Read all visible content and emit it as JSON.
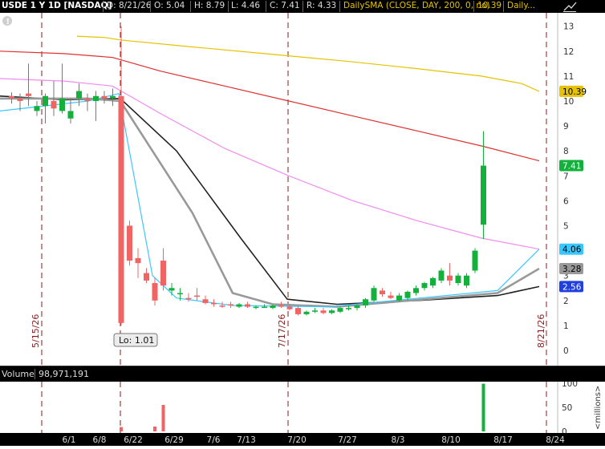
{
  "header": {
    "symbol": "USDE 1 Y 1D [NASDAQ]",
    "date": "D: 8/21/26",
    "open": "O: 5.04",
    "high": "H: 8.79",
    "low": "L: 4.46",
    "close": "C: 7.41",
    "range": "R: 4.33",
    "study": "DailySMA (CLOSE, DAY, 200, 0, no)",
    "study_value": "10.39",
    "more": "Daily..."
  },
  "price_axis": {
    "ticks": [
      13,
      12,
      11,
      10,
      9,
      8,
      7,
      6,
      5,
      4,
      3,
      2,
      1,
      0
    ],
    "tags": [
      {
        "text": "10.39",
        "value": 10.39,
        "bg": "#e6c200",
        "fg": "#000"
      },
      {
        "text": "7.41",
        "value": 7.41,
        "bg": "#13b13b",
        "fg": "#fff"
      },
      {
        "text": "4.06",
        "value": 4.06,
        "bg": "#38c8ff",
        "fg": "#000"
      },
      {
        "text": "3.28",
        "value": 3.28,
        "bg": "#999999",
        "fg": "#000"
      },
      {
        "text": "2.56",
        "value": 2.56,
        "bg": "#1f3fe0",
        "fg": "#fff"
      }
    ]
  },
  "event_labels": [
    "5/15/26",
    "7/17/26",
    "8/21/26"
  ],
  "lo_label": "Lo: 1.01",
  "volume": {
    "label": "Volume",
    "value": "98,971,191",
    "ticks": [
      "100",
      "50",
      "0"
    ],
    "unit": "<millions>"
  },
  "x_axis": {
    "labels": [
      "6/1",
      "6/8",
      "6/22",
      "6/29",
      "7/6",
      "7/13",
      "7/20",
      "7/27",
      "8/3",
      "8/10",
      "8/17",
      "8/24"
    ]
  },
  "colors": {
    "up": "#13b13b",
    "down": "#f06464",
    "sma200": "#e6c200",
    "ma_red": "#e03030",
    "ma_pink": "#f08cf0",
    "ma_black": "#222222",
    "ma_gray": "#999999",
    "ma_cyan": "#38c8ff"
  },
  "chart_data": {
    "type": "candlestick",
    "candles": [
      {
        "o": 10.2,
        "h": 10.35,
        "l": 9.9,
        "c": 10.1
      },
      {
        "o": 10.1,
        "h": 10.3,
        "l": 9.6,
        "c": 10.0
      },
      {
        "o": 10.3,
        "h": 11.5,
        "l": 9.8,
        "c": 10.2
      },
      {
        "o": 9.6,
        "h": 10.0,
        "l": 9.4,
        "c": 9.8
      },
      {
        "o": 9.8,
        "h": 10.3,
        "l": 9.1,
        "c": 10.2
      },
      {
        "o": 10.0,
        "h": 10.8,
        "l": 9.4,
        "c": 9.7
      },
      {
        "o": 9.6,
        "h": 11.5,
        "l": 9.5,
        "c": 10.1
      },
      {
        "o": 9.3,
        "h": 10.1,
        "l": 9.1,
        "c": 9.6
      },
      {
        "o": 10.1,
        "h": 10.7,
        "l": 9.8,
        "c": 10.4
      },
      {
        "o": 10.1,
        "h": 10.3,
        "l": 9.6,
        "c": 10.0
      },
      {
        "o": 10.0,
        "h": 10.4,
        "l": 9.2,
        "c": 10.2
      },
      {
        "o": 10.2,
        "h": 10.4,
        "l": 9.9,
        "c": 10.1
      },
      {
        "o": 10.1,
        "h": 10.5,
        "l": 9.8,
        "c": 10.2
      },
      {
        "o": 10.2,
        "h": 13.0,
        "l": 1.01,
        "c": 1.1
      },
      {
        "o": 5.0,
        "h": 5.2,
        "l": 3.4,
        "c": 3.6
      },
      {
        "o": 3.7,
        "h": 4.1,
        "l": 2.9,
        "c": 3.5
      },
      {
        "o": 3.1,
        "h": 3.3,
        "l": 2.7,
        "c": 2.8
      },
      {
        "o": 2.7,
        "h": 2.9,
        "l": 1.8,
        "c": 2.0
      },
      {
        "o": 3.6,
        "h": 4.1,
        "l": 2.4,
        "c": 2.6
      },
      {
        "o": 2.4,
        "h": 2.7,
        "l": 2.2,
        "c": 2.5
      },
      {
        "o": 2.3,
        "h": 2.5,
        "l": 2.0,
        "c": 2.3
      },
      {
        "o": 2.1,
        "h": 2.3,
        "l": 1.95,
        "c": 2.05
      },
      {
        "o": 2.2,
        "h": 2.5,
        "l": 2.0,
        "c": 2.15
      },
      {
        "o": 2.05,
        "h": 2.2,
        "l": 1.85,
        "c": 1.9
      },
      {
        "o": 1.9,
        "h": 2.05,
        "l": 1.75,
        "c": 1.85
      },
      {
        "o": 1.8,
        "h": 1.95,
        "l": 1.7,
        "c": 1.75
      },
      {
        "o": 1.85,
        "h": 1.95,
        "l": 1.7,
        "c": 1.8
      },
      {
        "o": 1.75,
        "h": 1.9,
        "l": 1.7,
        "c": 1.85
      },
      {
        "o": 1.85,
        "h": 1.95,
        "l": 1.7,
        "c": 1.75
      },
      {
        "o": 1.7,
        "h": 1.8,
        "l": 1.65,
        "c": 1.75
      },
      {
        "o": 1.75,
        "h": 1.85,
        "l": 1.7,
        "c": 1.75
      },
      {
        "o": 1.7,
        "h": 1.85,
        "l": 1.65,
        "c": 1.8
      },
      {
        "o": 1.8,
        "h": 1.95,
        "l": 1.7,
        "c": 1.75
      },
      {
        "o": 1.75,
        "h": 1.85,
        "l": 1.6,
        "c": 1.65
      },
      {
        "o": 1.7,
        "h": 1.8,
        "l": 1.4,
        "c": 1.45
      },
      {
        "o": 1.45,
        "h": 1.6,
        "l": 1.4,
        "c": 1.55
      },
      {
        "o": 1.55,
        "h": 1.7,
        "l": 1.5,
        "c": 1.6
      },
      {
        "o": 1.6,
        "h": 1.7,
        "l": 1.45,
        "c": 1.5
      },
      {
        "o": 1.5,
        "h": 1.65,
        "l": 1.45,
        "c": 1.6
      },
      {
        "o": 1.55,
        "h": 1.75,
        "l": 1.5,
        "c": 1.7
      },
      {
        "o": 1.65,
        "h": 1.8,
        "l": 1.6,
        "c": 1.7
      },
      {
        "o": 1.7,
        "h": 1.85,
        "l": 1.6,
        "c": 1.8
      },
      {
        "o": 1.8,
        "h": 2.1,
        "l": 1.7,
        "c": 2.05
      },
      {
        "o": 2.0,
        "h": 2.6,
        "l": 1.95,
        "c": 2.5
      },
      {
        "o": 2.4,
        "h": 2.5,
        "l": 2.15,
        "c": 2.25
      },
      {
        "o": 2.2,
        "h": 2.35,
        "l": 2.05,
        "c": 2.1
      },
      {
        "o": 2.0,
        "h": 2.3,
        "l": 1.95,
        "c": 2.2
      },
      {
        "o": 2.1,
        "h": 2.4,
        "l": 2.0,
        "c": 2.35
      },
      {
        "o": 2.3,
        "h": 2.6,
        "l": 2.2,
        "c": 2.5
      },
      {
        "o": 2.5,
        "h": 2.75,
        "l": 2.4,
        "c": 2.7
      },
      {
        "o": 2.6,
        "h": 2.95,
        "l": 2.5,
        "c": 2.9
      },
      {
        "o": 2.8,
        "h": 3.3,
        "l": 2.7,
        "c": 3.2
      },
      {
        "o": 3.0,
        "h": 3.5,
        "l": 2.6,
        "c": 2.8
      },
      {
        "o": 2.7,
        "h": 3.1,
        "l": 2.6,
        "c": 3.0
      },
      {
        "o": 2.6,
        "h": 3.1,
        "l": 2.5,
        "c": 3.0
      },
      {
        "o": 3.2,
        "h": 4.1,
        "l": 3.1,
        "c": 4.0
      },
      {
        "o": 5.04,
        "h": 8.79,
        "l": 4.46,
        "c": 7.41
      }
    ],
    "volume_spikes_millions": [
      {
        "bar": 13,
        "value": 9
      },
      {
        "bar": 17,
        "value": 10
      },
      {
        "bar": 18,
        "value": 55
      },
      {
        "bar": 56,
        "value": 99
      }
    ],
    "moving_averages": {
      "sma200": [
        12.6,
        12.55,
        12.45,
        12.2,
        11.9,
        11.6,
        11.3,
        11.0,
        10.7,
        10.39
      ],
      "red": [
        12.0,
        11.9,
        11.75,
        11.2,
        10.6,
        10.0,
        9.4,
        8.8,
        8.2,
        7.6
      ],
      "pink": [
        10.9,
        10.8,
        10.6,
        9.5,
        8.1,
        7.0,
        6.0,
        5.2,
        4.5,
        4.06
      ],
      "black": [
        10.2,
        10.05,
        10.1,
        8.0,
        4.5,
        2.05,
        1.85,
        2.0,
        2.2,
        2.56
      ],
      "gray": [
        10.1,
        10.1,
        10.0,
        5.5,
        2.3,
        1.85,
        1.75,
        2.3,
        3.28
      ],
      "cyan": [
        9.6,
        10.0,
        10.3,
        3.0,
        2.1,
        1.8,
        1.75,
        2.4,
        4.06
      ]
    }
  }
}
